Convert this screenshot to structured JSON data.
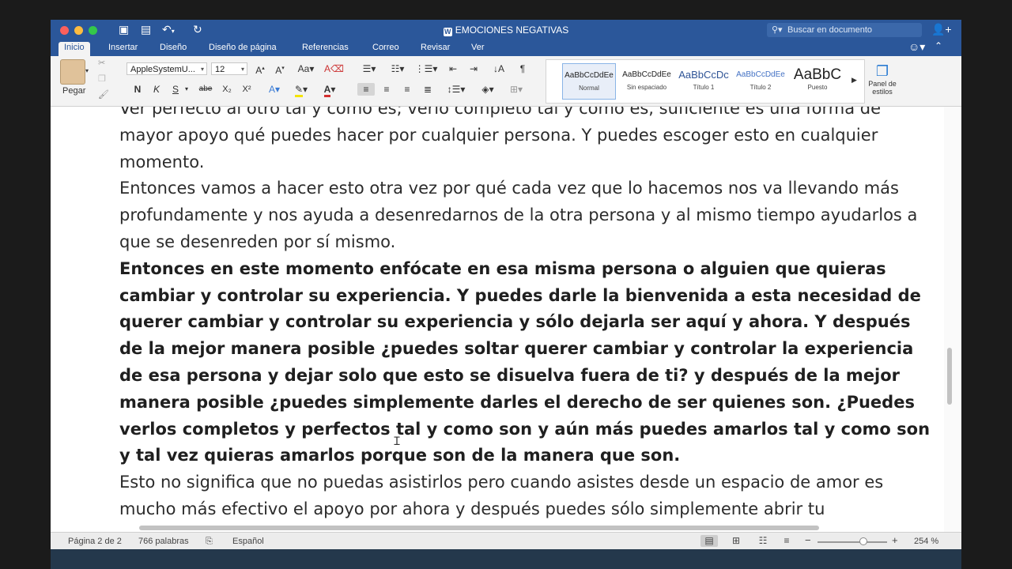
{
  "window": {
    "title": "EMOCIONES NEGATIVAS",
    "search_placeholder": "Buscar en documento"
  },
  "tabs": [
    "Inicio",
    "Insertar",
    "Diseño",
    "Diseño de página",
    "Referencias",
    "Correo",
    "Revisar",
    "Ver"
  ],
  "active_tab": "Inicio",
  "ribbon": {
    "paste_label": "Pegar",
    "font_name": "AppleSystemU...",
    "font_size": "12",
    "bold": "N",
    "italic": "K",
    "underline": "S",
    "strike": "abe",
    "subscript": "X₂",
    "superscript": "X²",
    "styles": [
      {
        "preview": "AaBbCcDdEe",
        "name": "Normal"
      },
      {
        "preview": "AaBbCcDdEe",
        "name": "Sin espaciado"
      },
      {
        "preview": "AaBbCcDc",
        "name": "Título 1"
      },
      {
        "preview": "AaBbCcDdEe",
        "name": "Título 2"
      },
      {
        "preview": "AaBbC",
        "name": "Puesto"
      }
    ],
    "styles_panel_label": "Panel de estilos"
  },
  "document": {
    "paragraphs": [
      {
        "text": "Ver perfecto al otro tal y como es; verlo completo tal y como es, suficiente  es una forma de mayor apoyo qué puedes hacer por cualquier persona. Y puedes escoger esto en cualquier momento.",
        "bold": false
      },
      {
        "text": " Entonces vamos a hacer esto otra vez por qué cada vez que lo hacemos nos va llevando más profundamente y nos ayuda a desenredarnos de la otra persona y  al mismo tiempo ayudarlos a que se desenreden por sí mismo.",
        "bold": false
      },
      {
        "text": "Entonces en este momento enfócate en esa misma persona o alguien que quieras cambiar y controlar su experiencia. Y puedes darle la bienvenida a esta necesidad de querer cambiar y controlar su experiencia y sólo dejarla ser aquí y ahora. Y después de la mejor manera posible ¿puedes soltar querer cambiar y controlar la experiencia de esa persona y dejar solo que esto se disuelva fuera de ti? y después de la mejor manera posible ¿puedes simplemente darles el derecho de ser quienes son. ¿Puedes verlos completos y perfectos tal y como son y aún más puedes amarlos tal y como son y tal vez quieras amarlos porque son de la manera que son.",
        "bold": true
      },
      {
        "text": " Esto no significa que no puedas asistirlos pero cuando asistes desde un espacio de amor es mucho más efectivo el apoyo por ahora y después puedes sólo simplemente abrir tu",
        "bold": false
      }
    ]
  },
  "status": {
    "page": "Página 2 de 2",
    "words": "766 palabras",
    "language": "Español",
    "zoom": "254 %",
    "zoom_minus": "−",
    "zoom_plus": "+"
  },
  "colors": {
    "titlebar": "#2b579a",
    "ribbon": "#f3f3f3",
    "highlight": "#f5e400",
    "font_color": "#d32f2f"
  }
}
